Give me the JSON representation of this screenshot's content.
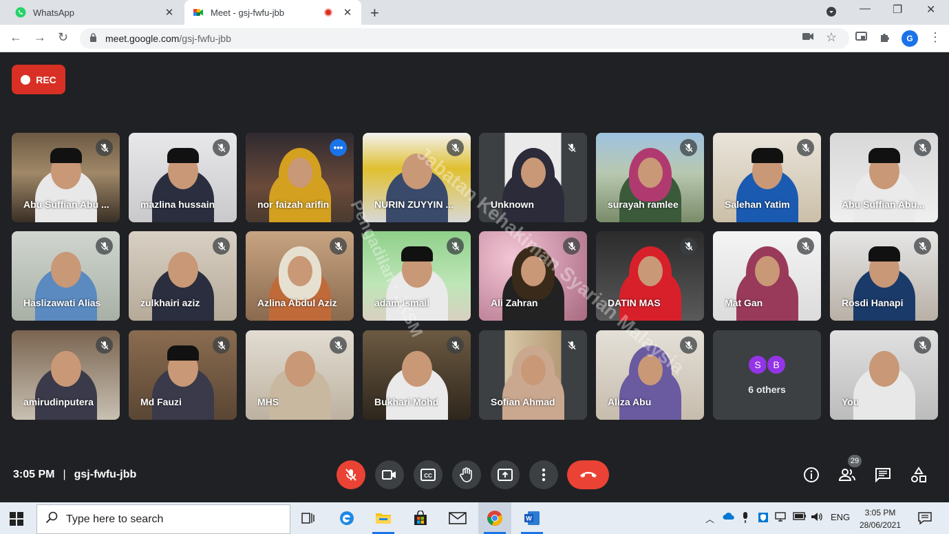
{
  "browser": {
    "tabs": [
      {
        "title": "WhatsApp",
        "active": false
      },
      {
        "title": "Meet - gsj-fwfu-jbb",
        "active": true
      }
    ],
    "url_domain": "meet.google.com",
    "url_path": "/gsj-fwfu-jbb",
    "profile_initial": "G",
    "accent": "#1a73e8"
  },
  "meet": {
    "rec_label": "REC",
    "participants": [
      {
        "name": "Abu Suffian Abu ...",
        "muted": true
      },
      {
        "name": "mazlina hussain",
        "muted": true
      },
      {
        "name": "nor faizah arifin",
        "muted": false,
        "speaking": true
      },
      {
        "name": "NURIN ZUYYIN ...",
        "muted": true
      },
      {
        "name": "Unknown",
        "muted": true
      },
      {
        "name": "surayah ramlee",
        "muted": true
      },
      {
        "name": "Salehan Yatim",
        "muted": true
      },
      {
        "name": "Abu Suffian Abu...",
        "muted": true
      },
      {
        "name": "Haslizawati Alias",
        "muted": true
      },
      {
        "name": "zulkhairi aziz",
        "muted": true
      },
      {
        "name": "Azlina Abdul Aziz",
        "muted": true
      },
      {
        "name": "adam ismail",
        "muted": true
      },
      {
        "name": "Ali Zahran",
        "muted": true
      },
      {
        "name": "DATIN MAS",
        "muted": true
      },
      {
        "name": "Mat Gan",
        "muted": true
      },
      {
        "name": "Rosdi Hanapi",
        "muted": true
      },
      {
        "name": "amirudinputera",
        "muted": true
      },
      {
        "name": "Md Fauzi",
        "muted": true
      },
      {
        "name": "MHS",
        "muted": true
      },
      {
        "name": "Bukhari Mohd",
        "muted": true
      },
      {
        "name": "Sofian Ahmad",
        "muted": true
      },
      {
        "name": "Aliza Abu",
        "muted": true
      },
      {
        "name": "You",
        "muted": true
      }
    ],
    "others": {
      "avatars": [
        "S",
        "B"
      ],
      "label": "6 others"
    },
    "watermark_lines": [
      "Jabatan Kehakiman Syariah Malaysia",
      "Pengadilan · JKSM"
    ],
    "time": "3:05 PM",
    "separator": "|",
    "meeting_code": "gsj-fwfu-jbb",
    "people_count": "29"
  },
  "taskbar": {
    "search_placeholder": "Type here to search",
    "lang": "ENG",
    "time": "3:05 PM",
    "date": "28/06/2021"
  }
}
